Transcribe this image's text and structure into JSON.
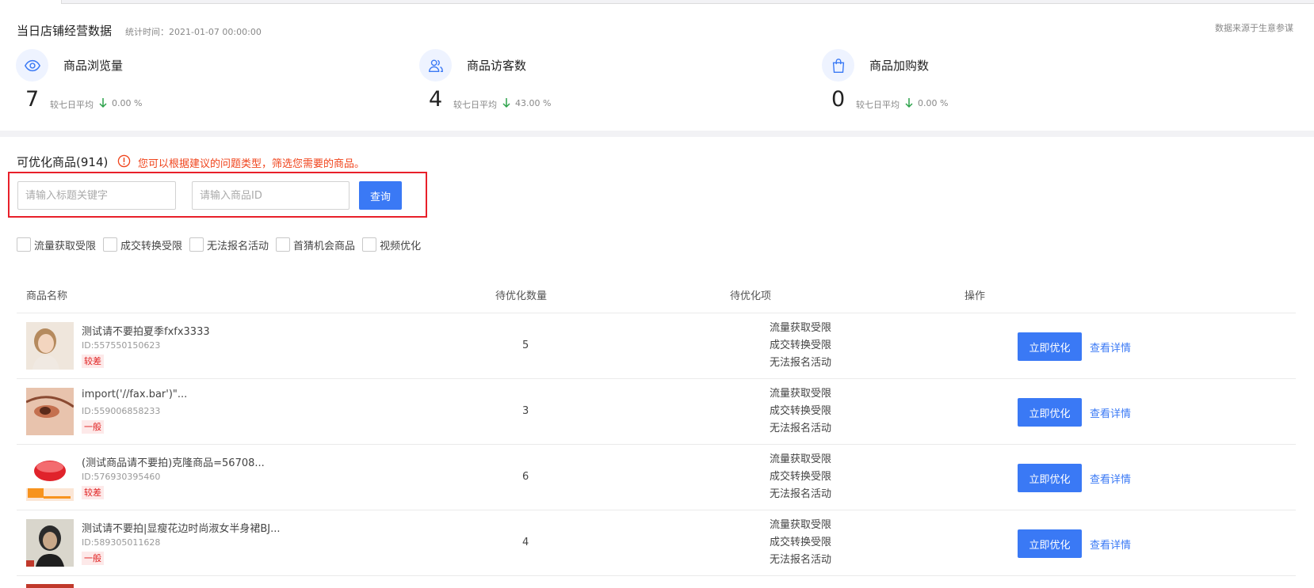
{
  "stats": {
    "title": "当日店铺经营数据",
    "time": "统计时间：2021-01-07 00:00:00",
    "source": "数据来源于生意参谋",
    "compare_label": "较七日平均",
    "metrics": [
      {
        "label": "商品浏览量",
        "value": "7",
        "pct": "0.00 %",
        "icon": "eye-icon"
      },
      {
        "label": "商品访客数",
        "value": "4",
        "pct": "43.00 %",
        "icon": "visitors-icon"
      },
      {
        "label": "商品加购数",
        "value": "0",
        "pct": "0.00 %",
        "icon": "shopping-bag-icon"
      }
    ]
  },
  "section": {
    "title": "可优化商品(914)",
    "tip": "您可以根据建议的问题类型，筛选您需要的商品。"
  },
  "search": {
    "title_placeholder": "请输入标题关键字",
    "id_placeholder": "请输入商品ID",
    "query_label": "查询"
  },
  "filters": [
    "流量获取受限",
    "成交转换受限",
    "无法报名活动",
    "首猜机会商品",
    "视频优化"
  ],
  "table": {
    "headers": [
      "商品名称",
      "待优化数量",
      "待优化项",
      "操作"
    ],
    "optimize_label": "立即优化",
    "detail_label": "查看详情",
    "rows": [
      {
        "name": "测试请不要拍夏季fxfx3333",
        "id": "ID:557550150623",
        "grade": "较差",
        "count": "5",
        "items": [
          "流量获取受限",
          "成交转换受限",
          "无法报名活动"
        ]
      },
      {
        "name": "import('//fax.bar')\"...",
        "id": "ID:559006858233",
        "grade": "一般",
        "count": "3",
        "items": [
          "流量获取受限",
          "成交转换受限",
          "无法报名活动"
        ]
      },
      {
        "name": "(测试商品请不要拍)克隆商品=56708...",
        "id": "ID:576930395460",
        "grade": "较差",
        "count": "6",
        "items": [
          "流量获取受限",
          "成交转换受限",
          "无法报名活动"
        ]
      },
      {
        "name": "测试请不要拍|显瘦花边时尚淑女半身裙BJ...",
        "id": "ID:589305011628",
        "grade": "一般",
        "count": "4",
        "items": [
          "流量获取受限",
          "成交转换受限",
          "无法报名活动"
        ]
      }
    ]
  },
  "colors": {
    "primary": "#3a79f5",
    "warning": "#f0441c",
    "highlight_border": "#e8202a",
    "down_arrow": "#2ca24a"
  }
}
